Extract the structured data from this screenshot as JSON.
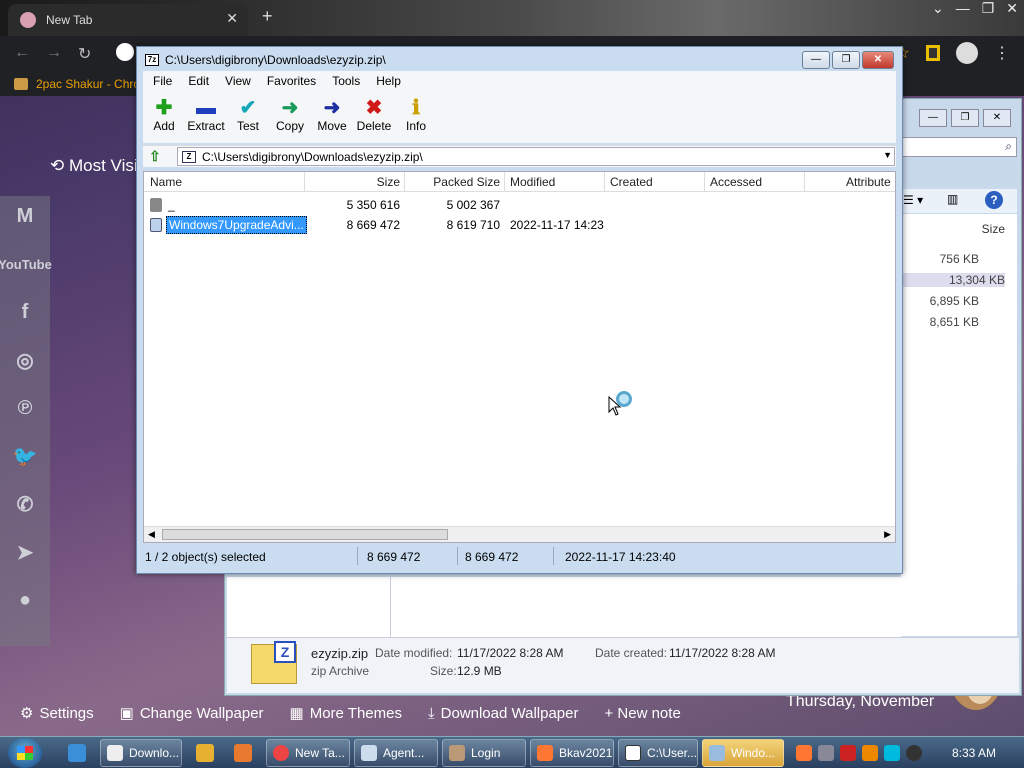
{
  "chrome": {
    "tab_title": "New Tab",
    "bookmark": "2pac Shakur - Chro",
    "most_visited": "Most Visi",
    "bottom_links": [
      "Settings",
      "Change Wallpaper",
      "More Themes",
      "Download Wallpaper",
      "+ New note"
    ],
    "date_text": "Thursday, November",
    "social_icons": [
      "gmail-icon",
      "youtube-icon",
      "facebook-icon",
      "instagram-icon",
      "pinterest-icon",
      "twitter-icon",
      "whatsapp-icon",
      "telegram-icon",
      "reddit-icon"
    ],
    "youtube_label": "YouTube"
  },
  "explorer": {
    "size_header": "Size",
    "sizes": [
      "756 KB",
      "13,304 KB",
      "6,895 KB",
      "8,651 KB"
    ],
    "details": {
      "file_name": "ezyzip.zip",
      "file_type": "zip Archive",
      "modified_label": "Date modified:",
      "modified_value": "11/17/2022 8:28 AM",
      "created_label": "Date created:",
      "created_value": "11/17/2022 8:28 AM",
      "size_label": "Size:",
      "size_value": "12.9 MB"
    }
  },
  "sevenzip": {
    "title": "C:\\Users\\digibrony\\Downloads\\ezyzip.zip\\",
    "app_icon_label": "7z",
    "menu": [
      "File",
      "Edit",
      "View",
      "Favorites",
      "Tools",
      "Help"
    ],
    "toolbar": [
      {
        "label": "Add",
        "glyph": "✚",
        "color": "#1ea01e"
      },
      {
        "label": "Extract",
        "glyph": "▬",
        "color": "#1f3fbf"
      },
      {
        "label": "Test",
        "glyph": "✔",
        "color": "#17a8b8"
      },
      {
        "label": "Copy",
        "glyph": "➜",
        "color": "#1a9a5a"
      },
      {
        "label": "Move",
        "glyph": "➜",
        "color": "#1f2f9f"
      },
      {
        "label": "Delete",
        "glyph": "✖",
        "color": "#d01818"
      },
      {
        "label": "Info",
        "glyph": "ℹ",
        "color": "#c8a000"
      }
    ],
    "address": "C:\\Users\\digibrony\\Downloads\\ezyzip.zip\\",
    "columns": [
      "Name",
      "Size",
      "Packed Size",
      "Modified",
      "Created",
      "Accessed",
      "Attribute"
    ],
    "rows": [
      {
        "name": "_",
        "size": "5 350 616",
        "packed": "5 002 367",
        "modified": "",
        "selected": false
      },
      {
        "name": "Windows7UpgradeAdvi...",
        "size": "8 669 472",
        "packed": "8 619 710",
        "modified": "2022-11-17 14:23",
        "selected": true
      }
    ],
    "status": {
      "selection": "1 / 2 object(s) selected",
      "size": "8 669 472",
      "packed": "8 669 472",
      "date": "2022-11-17 14:23:40"
    }
  },
  "taskbar": {
    "buttons": [
      "Downlo...",
      "New Ta...",
      "Agent...",
      "Login",
      "Bkav2021",
      "C:\\User...",
      "Windo..."
    ],
    "clock": "8:33 AM"
  }
}
